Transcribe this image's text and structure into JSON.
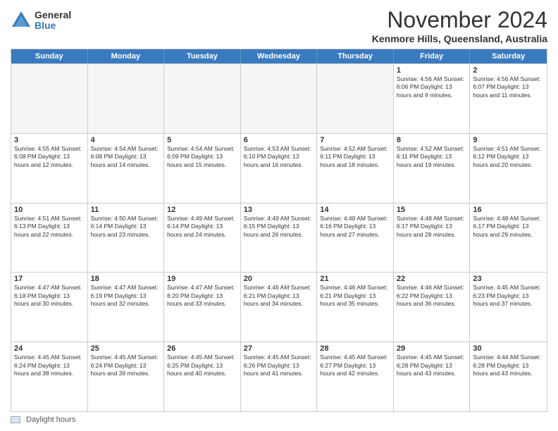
{
  "header": {
    "logo_general": "General",
    "logo_blue": "Blue",
    "month_title": "November 2024",
    "subtitle": "Kenmore Hills, Queensland, Australia"
  },
  "days_of_week": [
    "Sunday",
    "Monday",
    "Tuesday",
    "Wednesday",
    "Thursday",
    "Friday",
    "Saturday"
  ],
  "legend_label": "Daylight hours",
  "weeks": [
    [
      {
        "day": "",
        "empty": true
      },
      {
        "day": "",
        "empty": true
      },
      {
        "day": "",
        "empty": true
      },
      {
        "day": "",
        "empty": true
      },
      {
        "day": "",
        "empty": true
      },
      {
        "day": "1",
        "info": "Sunrise: 4:56 AM\nSunset: 6:06 PM\nDaylight: 13 hours\nand 9 minutes."
      },
      {
        "day": "2",
        "info": "Sunrise: 4:56 AM\nSunset: 6:07 PM\nDaylight: 13 hours\nand 11 minutes."
      }
    ],
    [
      {
        "day": "3",
        "info": "Sunrise: 4:55 AM\nSunset: 6:08 PM\nDaylight: 13 hours\nand 12 minutes."
      },
      {
        "day": "4",
        "info": "Sunrise: 4:54 AM\nSunset: 6:08 PM\nDaylight: 13 hours\nand 14 minutes."
      },
      {
        "day": "5",
        "info": "Sunrise: 4:54 AM\nSunset: 6:09 PM\nDaylight: 13 hours\nand 15 minutes."
      },
      {
        "day": "6",
        "info": "Sunrise: 4:53 AM\nSunset: 6:10 PM\nDaylight: 13 hours\nand 16 minutes."
      },
      {
        "day": "7",
        "info": "Sunrise: 4:52 AM\nSunset: 6:11 PM\nDaylight: 13 hours\nand 18 minutes."
      },
      {
        "day": "8",
        "info": "Sunrise: 4:52 AM\nSunset: 6:11 PM\nDaylight: 13 hours\nand 19 minutes."
      },
      {
        "day": "9",
        "info": "Sunrise: 4:51 AM\nSunset: 6:12 PM\nDaylight: 13 hours\nand 20 minutes."
      }
    ],
    [
      {
        "day": "10",
        "info": "Sunrise: 4:51 AM\nSunset: 6:13 PM\nDaylight: 13 hours\nand 22 minutes."
      },
      {
        "day": "11",
        "info": "Sunrise: 4:50 AM\nSunset: 6:14 PM\nDaylight: 13 hours\nand 23 minutes."
      },
      {
        "day": "12",
        "info": "Sunrise: 4:49 AM\nSunset: 6:14 PM\nDaylight: 13 hours\nand 24 minutes."
      },
      {
        "day": "13",
        "info": "Sunrise: 4:49 AM\nSunset: 6:15 PM\nDaylight: 13 hours\nand 26 minutes."
      },
      {
        "day": "14",
        "info": "Sunrise: 4:48 AM\nSunset: 6:16 PM\nDaylight: 13 hours\nand 27 minutes."
      },
      {
        "day": "15",
        "info": "Sunrise: 4:48 AM\nSunset: 6:17 PM\nDaylight: 13 hours\nand 28 minutes."
      },
      {
        "day": "16",
        "info": "Sunrise: 4:48 AM\nSunset: 6:17 PM\nDaylight: 13 hours\nand 29 minutes."
      }
    ],
    [
      {
        "day": "17",
        "info": "Sunrise: 4:47 AM\nSunset: 6:18 PM\nDaylight: 13 hours\nand 30 minutes."
      },
      {
        "day": "18",
        "info": "Sunrise: 4:47 AM\nSunset: 6:19 PM\nDaylight: 13 hours\nand 32 minutes."
      },
      {
        "day": "19",
        "info": "Sunrise: 4:47 AM\nSunset: 6:20 PM\nDaylight: 13 hours\nand 33 minutes."
      },
      {
        "day": "20",
        "info": "Sunrise: 4:46 AM\nSunset: 6:21 PM\nDaylight: 13 hours\nand 34 minutes."
      },
      {
        "day": "21",
        "info": "Sunrise: 4:46 AM\nSunset: 6:21 PM\nDaylight: 13 hours\nand 35 minutes."
      },
      {
        "day": "22",
        "info": "Sunrise: 4:46 AM\nSunset: 6:22 PM\nDaylight: 13 hours\nand 36 minutes."
      },
      {
        "day": "23",
        "info": "Sunrise: 4:45 AM\nSunset: 6:23 PM\nDaylight: 13 hours\nand 37 minutes."
      }
    ],
    [
      {
        "day": "24",
        "info": "Sunrise: 4:45 AM\nSunset: 6:24 PM\nDaylight: 13 hours\nand 38 minutes."
      },
      {
        "day": "25",
        "info": "Sunrise: 4:45 AM\nSunset: 6:24 PM\nDaylight: 13 hours\nand 39 minutes."
      },
      {
        "day": "26",
        "info": "Sunrise: 4:45 AM\nSunset: 6:25 PM\nDaylight: 13 hours\nand 40 minutes."
      },
      {
        "day": "27",
        "info": "Sunrise: 4:45 AM\nSunset: 6:26 PM\nDaylight: 13 hours\nand 41 minutes."
      },
      {
        "day": "28",
        "info": "Sunrise: 4:45 AM\nSunset: 6:27 PM\nDaylight: 13 hours\nand 42 minutes."
      },
      {
        "day": "29",
        "info": "Sunrise: 4:45 AM\nSunset: 6:28 PM\nDaylight: 13 hours\nand 43 minutes."
      },
      {
        "day": "30",
        "info": "Sunrise: 4:44 AM\nSunset: 6:28 PM\nDaylight: 13 hours\nand 43 minutes."
      }
    ]
  ]
}
